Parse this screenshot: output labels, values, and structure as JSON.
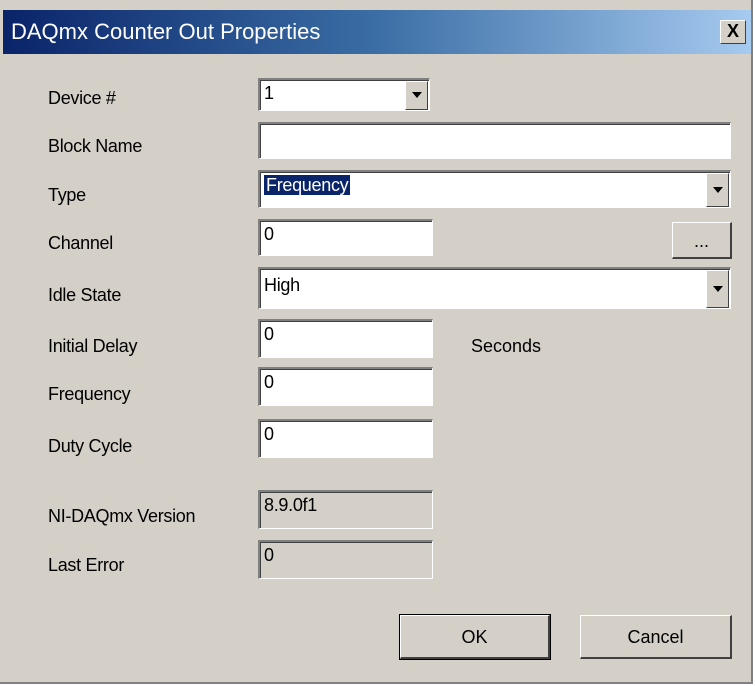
{
  "window": {
    "title": "DAQmx Counter Out Properties",
    "close_glyph": "X"
  },
  "form": {
    "device": {
      "label": "Device #",
      "value": "1"
    },
    "block_name": {
      "label": "Block Name",
      "value": ""
    },
    "type": {
      "label": "Type",
      "value": "Frequency"
    },
    "channel": {
      "label": "Channel",
      "value": "0",
      "browse_label": "..."
    },
    "idle_state": {
      "label": "Idle State",
      "value": "High"
    },
    "initial_delay": {
      "label": "Initial Delay",
      "value": "0",
      "unit": "Seconds"
    },
    "frequency": {
      "label": "Frequency",
      "value": "0"
    },
    "duty_cycle": {
      "label": "Duty Cycle",
      "value": "0"
    },
    "version": {
      "label": "NI-DAQmx Version",
      "value": "8.9.0f1"
    },
    "last_error": {
      "label": "Last Error",
      "value": "0"
    }
  },
  "buttons": {
    "ok": "OK",
    "cancel": "Cancel"
  }
}
